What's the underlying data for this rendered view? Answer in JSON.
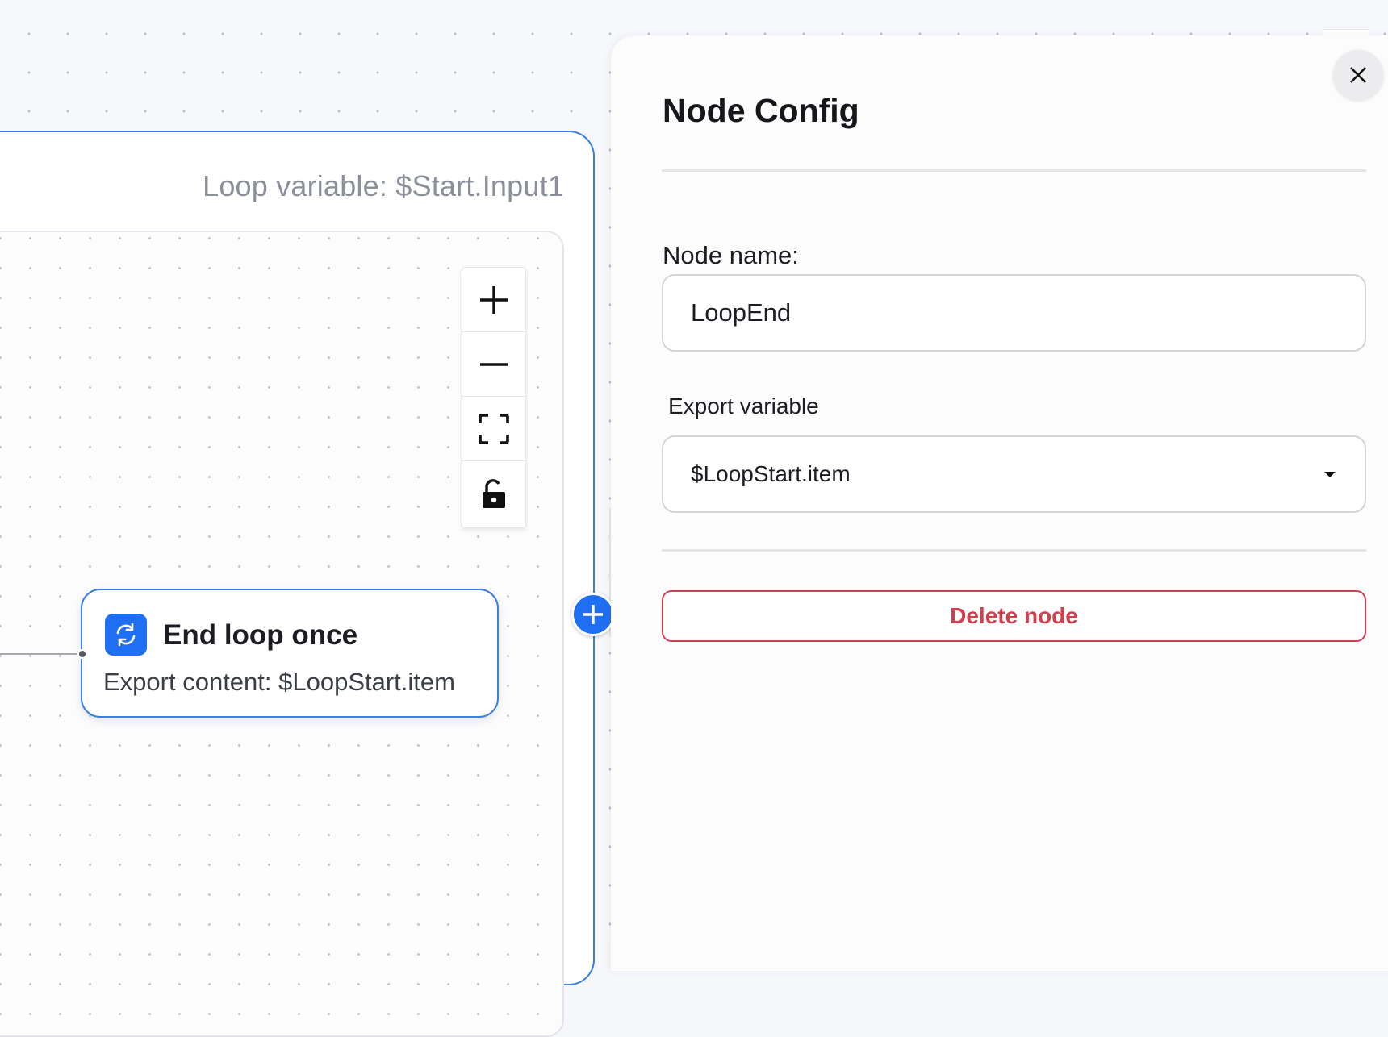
{
  "loop": {
    "variable_label": "Loop variable: $Start.Input1"
  },
  "controls": {
    "zoom_in": "zoom-in",
    "zoom_out": "zoom-out",
    "fit_view": "fit-view",
    "lock": "unlock"
  },
  "node": {
    "title": "End loop once",
    "description": "Export content: $LoopStart.item",
    "icon": "loop-icon"
  },
  "panel": {
    "title": "Node Config",
    "node_name_label": "Node name:",
    "node_name_value": "LoopEnd",
    "export_variable_label": "Export variable",
    "export_variable_value": "$LoopStart.item",
    "delete_label": "Delete node"
  },
  "colors": {
    "accent": "#1f6ff2",
    "container_border": "#3b7fe0",
    "danger": "#d0404e"
  }
}
